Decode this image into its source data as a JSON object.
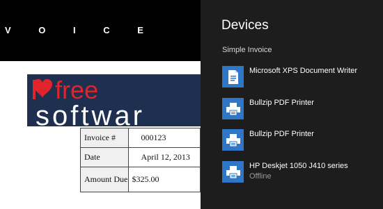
{
  "document": {
    "title": "V O I C E",
    "logo": {
      "line1": "free",
      "line2": "softwar",
      "name": "I Love Free Software logo"
    },
    "table": [
      {
        "label": "Invoice #",
        "value": "000123"
      },
      {
        "label": "Date",
        "value": "April 12, 2013"
      },
      {
        "label": "Amount Due",
        "value": "$325.00"
      }
    ]
  },
  "panel": {
    "title": "Devices",
    "subtitle": "Simple Invoice",
    "devices": [
      {
        "name": "Microsoft XPS Document Writer",
        "status": "",
        "icon": "document-writer-icon"
      },
      {
        "name": "Bullzip PDF Printer",
        "status": "",
        "icon": "printer-icon"
      },
      {
        "name": "Bullzip PDF Printer",
        "status": "",
        "icon": "printer-icon"
      },
      {
        "name": "HP Deskjet 1050 J410 series",
        "status": "Offline",
        "icon": "printer-icon"
      }
    ]
  },
  "colors": {
    "panel_bg": "#1d1d1d",
    "icon_tile": "#2f76c6",
    "header_bg": "#000000",
    "logo_bg": "#1f2f4f",
    "logo_red": "#e0242c"
  }
}
